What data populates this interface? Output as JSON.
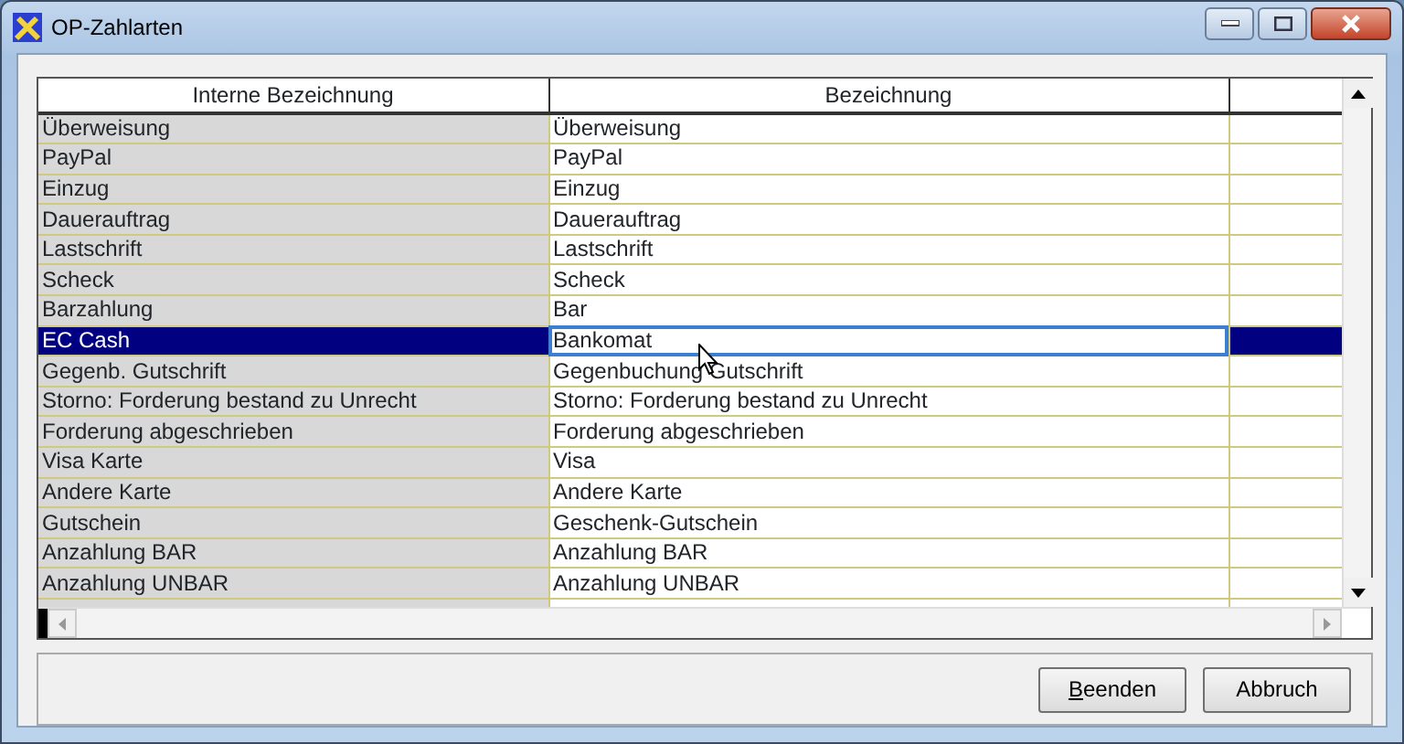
{
  "window": {
    "title": "OP-Zahlarten"
  },
  "table": {
    "columns": [
      "Interne Bezeichnung",
      "Bezeichnung",
      ""
    ],
    "rows": [
      {
        "internal": "Überweisung",
        "name": "Überweisung",
        "selected": false
      },
      {
        "internal": "PayPal",
        "name": "PayPal",
        "selected": false
      },
      {
        "internal": "Einzug",
        "name": "Einzug",
        "selected": false
      },
      {
        "internal": "Dauerauftrag",
        "name": "Dauerauftrag",
        "selected": false
      },
      {
        "internal": "Lastschrift",
        "name": "Lastschrift",
        "selected": false
      },
      {
        "internal": "Scheck",
        "name": "Scheck",
        "selected": false
      },
      {
        "internal": "Barzahlung",
        "name": "Bar",
        "selected": false
      },
      {
        "internal": "EC Cash",
        "name": "Bankomat",
        "selected": true
      },
      {
        "internal": "Gegenb. Gutschrift",
        "name": "Gegenbuchung Gutschrift",
        "selected": false
      },
      {
        "internal": "Storno: Forderung bestand zu Unrecht",
        "name": "Storno: Forderung bestand zu Unrecht",
        "selected": false
      },
      {
        "internal": "Forderung abgeschrieben",
        "name": "Forderung abgeschrieben",
        "selected": false
      },
      {
        "internal": "Visa Karte",
        "name": "Visa",
        "selected": false
      },
      {
        "internal": "Andere Karte",
        "name": "Andere Karte",
        "selected": false
      },
      {
        "internal": "Gutschein",
        "name": "Geschenk-Gutschein",
        "selected": false
      },
      {
        "internal": "Anzahlung BAR",
        "name": "Anzahlung BAR",
        "selected": false
      },
      {
        "internal": "Anzahlung UNBAR",
        "name": "Anzahlung UNBAR",
        "selected": false
      }
    ]
  },
  "buttons": [
    {
      "label": "Beenden",
      "mnemonic_underlined": true
    },
    {
      "label": "Abbruch",
      "mnemonic_underlined": false
    }
  ]
}
